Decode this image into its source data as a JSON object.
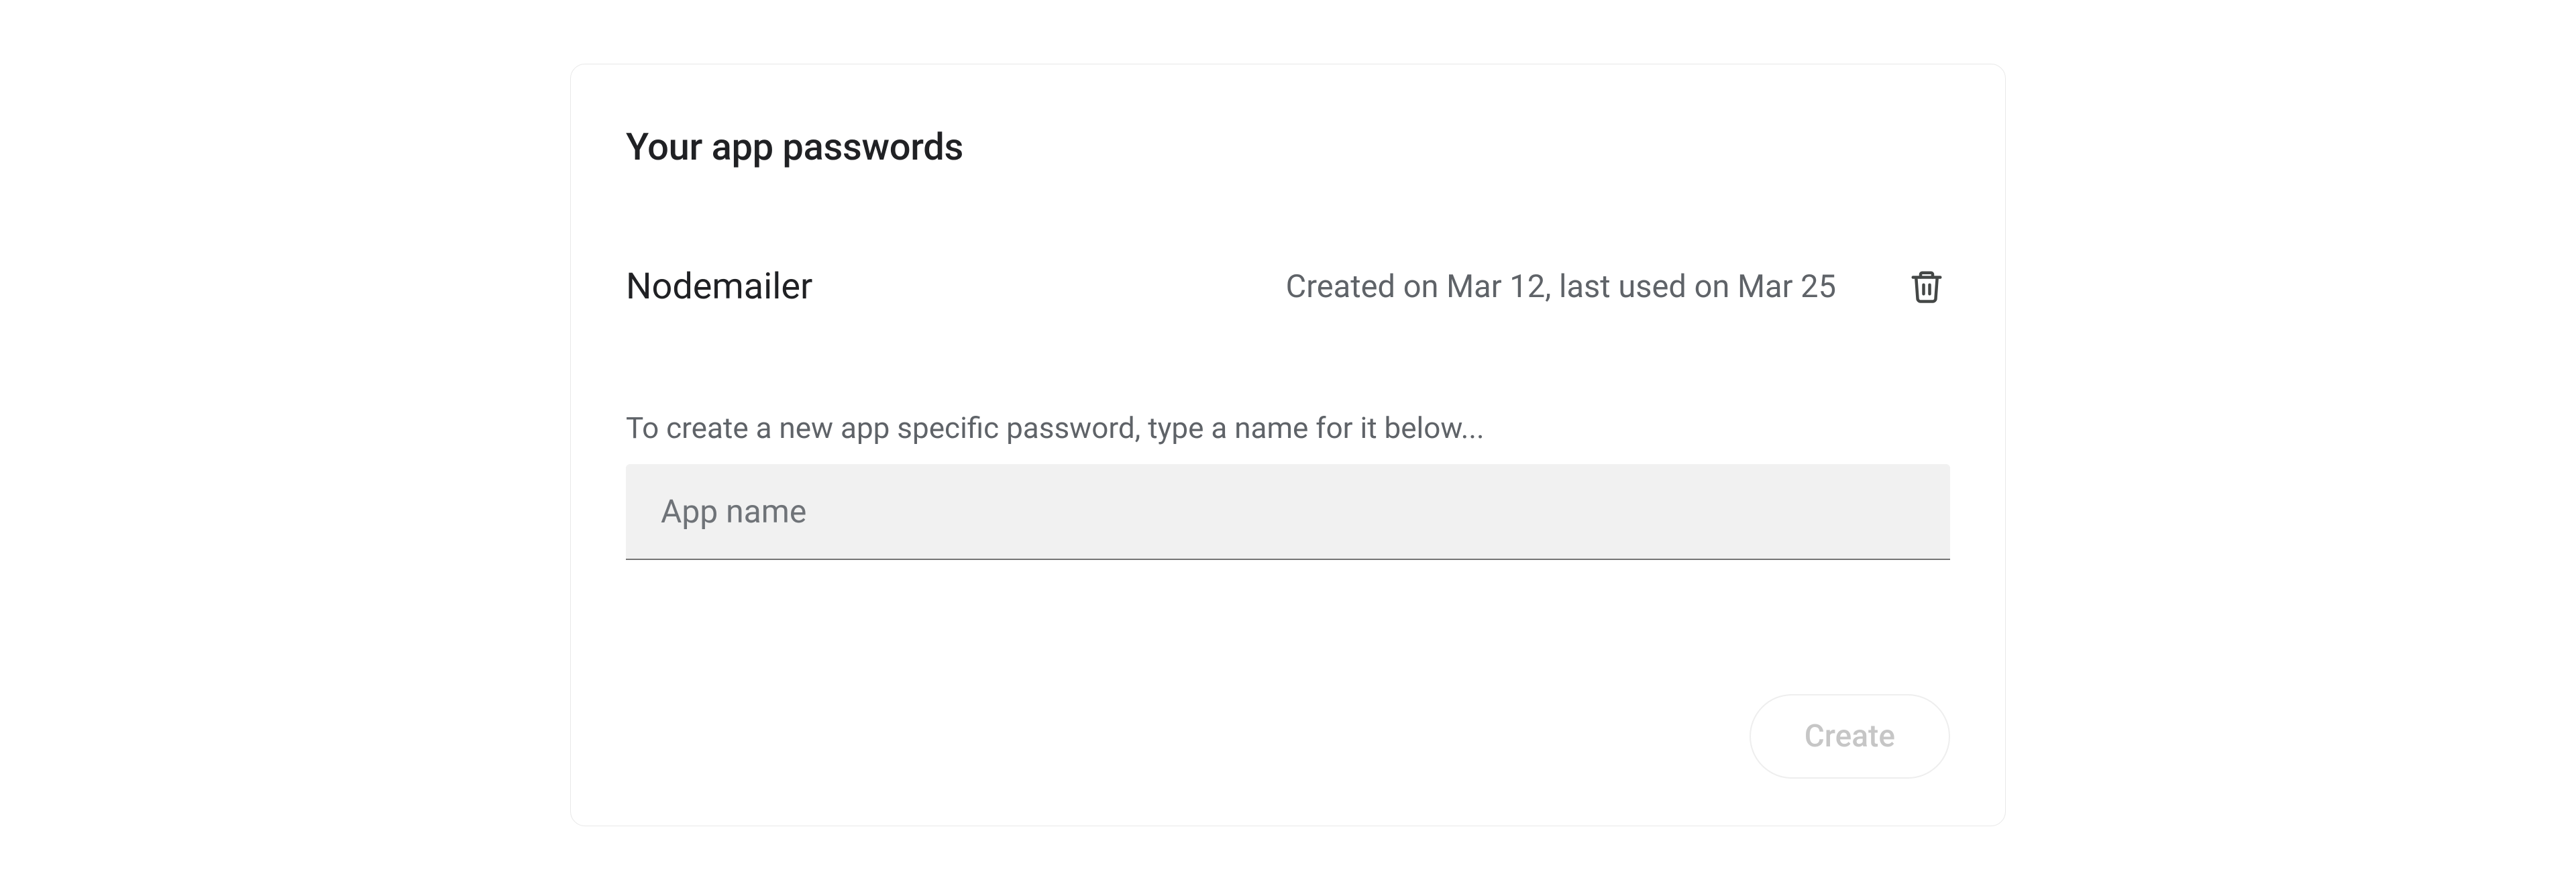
{
  "card": {
    "title": "Your app passwords",
    "passwords": [
      {
        "name": "Nodemailer",
        "meta": "Created on Mar 12, last used on Mar 25"
      }
    ],
    "helper": "To create a new app specific password, type a name for it below...",
    "input": {
      "placeholder": "App name",
      "value": ""
    },
    "create_label": "Create"
  },
  "icons": {
    "trash": "trash-icon"
  }
}
